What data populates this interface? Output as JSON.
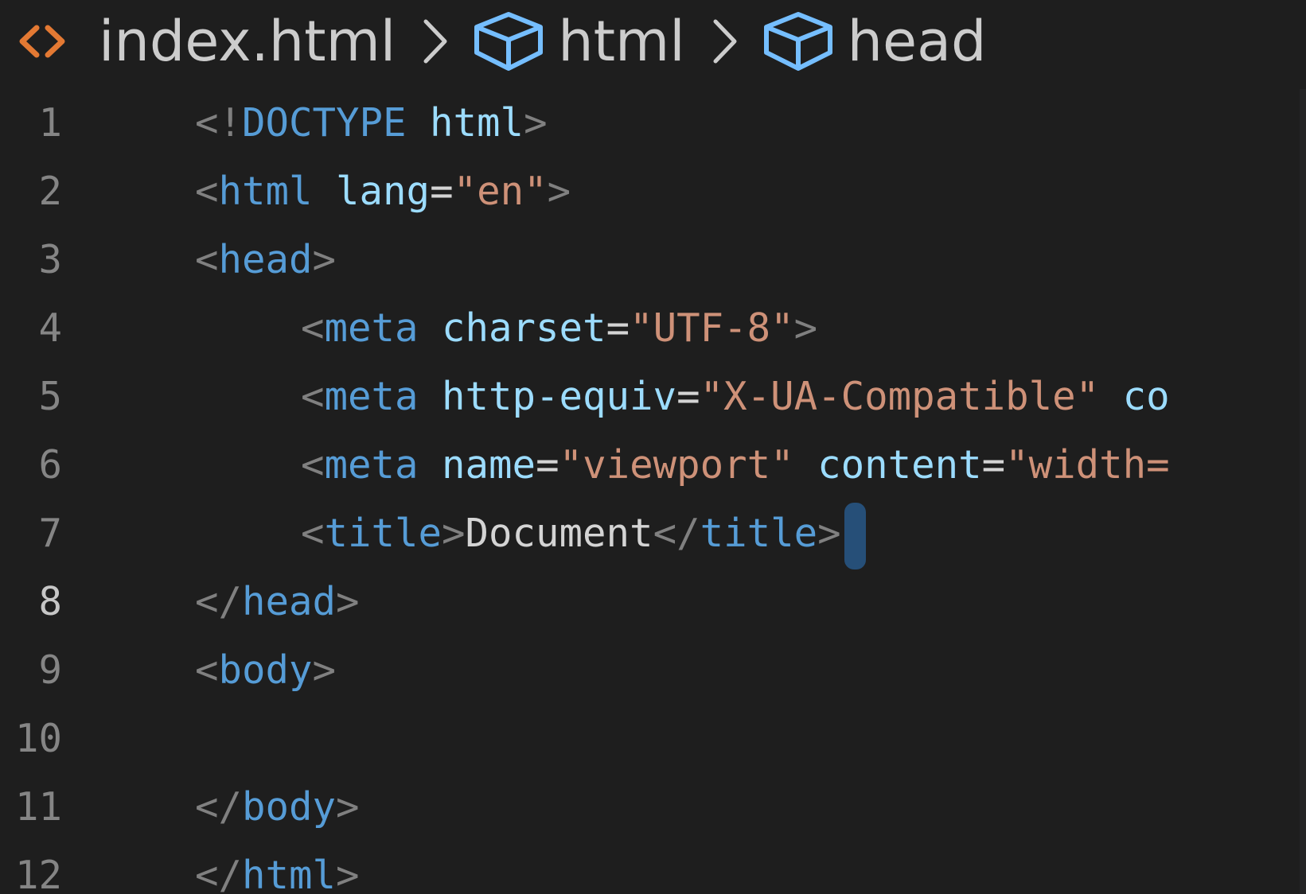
{
  "breadcrumb": {
    "file": "index.html",
    "path": [
      "html",
      "head"
    ],
    "icons": {
      "file": "code-brackets-icon",
      "symbol": "cube-icon",
      "separator": "chevron-right-icon"
    }
  },
  "colors": {
    "background": "#1e1e1e",
    "tag": "#569cd6",
    "attribute": "#9cdcfe",
    "string": "#ce9178",
    "punctuation": "#808080",
    "text": "#d4d4d4",
    "file_icon": "#e37933",
    "symbol_icon": "#75beff",
    "cursor": "#264f78"
  },
  "editor": {
    "active_line": "8",
    "lines": [
      {
        "number": "1",
        "tokens": [
          {
            "t": "<!",
            "k": "punc"
          },
          {
            "t": "DOCTYPE",
            "k": "tag"
          },
          {
            "t": " ",
            "k": "txt"
          },
          {
            "t": "html",
            "k": "attr"
          },
          {
            "t": ">",
            "k": "punc"
          }
        ]
      },
      {
        "number": "2",
        "tokens": [
          {
            "t": "<",
            "k": "punc"
          },
          {
            "t": "html",
            "k": "tag"
          },
          {
            "t": " ",
            "k": "txt"
          },
          {
            "t": "lang",
            "k": "attr"
          },
          {
            "t": "=",
            "k": "txt"
          },
          {
            "t": "\"en\"",
            "k": "str"
          },
          {
            "t": ">",
            "k": "punc"
          }
        ]
      },
      {
        "number": "3",
        "tokens": [
          {
            "t": "<",
            "k": "punc"
          },
          {
            "t": "head",
            "k": "tag"
          },
          {
            "t": ">",
            "k": "punc"
          }
        ]
      },
      {
        "number": "4",
        "indent": true,
        "tokens": [
          {
            "t": "<",
            "k": "punc"
          },
          {
            "t": "meta",
            "k": "tag"
          },
          {
            "t": " ",
            "k": "txt"
          },
          {
            "t": "charset",
            "k": "attr"
          },
          {
            "t": "=",
            "k": "txt"
          },
          {
            "t": "\"UTF-8\"",
            "k": "str"
          },
          {
            "t": ">",
            "k": "punc"
          }
        ]
      },
      {
        "number": "5",
        "indent": true,
        "tokens": [
          {
            "t": "<",
            "k": "punc"
          },
          {
            "t": "meta",
            "k": "tag"
          },
          {
            "t": " ",
            "k": "txt"
          },
          {
            "t": "http-equiv",
            "k": "attr"
          },
          {
            "t": "=",
            "k": "txt"
          },
          {
            "t": "\"X-UA-Compatible\"",
            "k": "str"
          },
          {
            "t": " ",
            "k": "txt"
          },
          {
            "t": "co",
            "k": "attr"
          }
        ]
      },
      {
        "number": "6",
        "indent": true,
        "tokens": [
          {
            "t": "<",
            "k": "punc"
          },
          {
            "t": "meta",
            "k": "tag"
          },
          {
            "t": " ",
            "k": "txt"
          },
          {
            "t": "name",
            "k": "attr"
          },
          {
            "t": "=",
            "k": "txt"
          },
          {
            "t": "\"viewport\"",
            "k": "str"
          },
          {
            "t": " ",
            "k": "txt"
          },
          {
            "t": "content",
            "k": "attr"
          },
          {
            "t": "=",
            "k": "txt"
          },
          {
            "t": "\"width=",
            "k": "str"
          }
        ]
      },
      {
        "number": "7",
        "indent": true,
        "cursor": true,
        "tokens": [
          {
            "t": "<",
            "k": "punc"
          },
          {
            "t": "title",
            "k": "tag"
          },
          {
            "t": ">",
            "k": "punc"
          },
          {
            "t": "Document",
            "k": "txt"
          },
          {
            "t": "</",
            "k": "punc"
          },
          {
            "t": "title",
            "k": "tag"
          },
          {
            "t": ">",
            "k": "punc"
          }
        ]
      },
      {
        "number": "8",
        "tokens": [
          {
            "t": "</",
            "k": "punc"
          },
          {
            "t": "head",
            "k": "tag"
          },
          {
            "t": ">",
            "k": "punc"
          }
        ]
      },
      {
        "number": "9",
        "tokens": [
          {
            "t": "<",
            "k": "punc"
          },
          {
            "t": "body",
            "k": "tag"
          },
          {
            "t": ">",
            "k": "punc"
          }
        ]
      },
      {
        "number": "10",
        "tokens": []
      },
      {
        "number": "11",
        "tokens": [
          {
            "t": "</",
            "k": "punc"
          },
          {
            "t": "body",
            "k": "tag"
          },
          {
            "t": ">",
            "k": "punc"
          }
        ]
      },
      {
        "number": "12",
        "tokens": [
          {
            "t": "</",
            "k": "punc"
          },
          {
            "t": "html",
            "k": "tag"
          },
          {
            "t": ">",
            "k": "punc"
          }
        ]
      }
    ]
  }
}
